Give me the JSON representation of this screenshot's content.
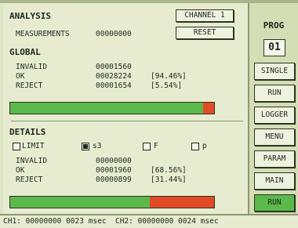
{
  "analysis": {
    "title": "ANALYSIS",
    "channel_button": "CHANNEL 1",
    "reset_button": "RESET",
    "measurements_label": "MEASUREMENTS",
    "measurements_value": "00000000"
  },
  "global": {
    "title": "GLOBAL",
    "rows": [
      {
        "label": "INVALID",
        "value": "00001560",
        "percent": ""
      },
      {
        "label": "OK",
        "value": "00028224",
        "percent": "[94.46%]"
      },
      {
        "label": "REJECT",
        "value": "00001654",
        "percent": "[5.54%]"
      }
    ],
    "bar": {
      "ok_percent": 94.46,
      "reject_percent": 5.54
    }
  },
  "details": {
    "title": "DETAILS",
    "checkboxes": [
      {
        "label": "LIMIT",
        "checked": false
      },
      {
        "label": "s3",
        "checked": true
      },
      {
        "label": "F",
        "checked": false
      },
      {
        "label": "p",
        "checked": false
      }
    ],
    "rows": [
      {
        "label": "INVALID",
        "value": "00000000",
        "percent": ""
      },
      {
        "label": "OK",
        "value": "00001960",
        "percent": "[68.56%]"
      },
      {
        "label": "REJECT",
        "value": "00000899",
        "percent": "[31.44%]"
      }
    ],
    "bar": {
      "ok_percent": 68.56,
      "reject_percent": 31.44
    }
  },
  "side": {
    "prog_label": "PROG",
    "prog_value": "01",
    "buttons": [
      "SINGLE",
      "RUN",
      "LOGGER",
      "MENU",
      "PARAM",
      "MAIN",
      "RUN"
    ]
  },
  "status": {
    "text": "CH1: 00000000 0023 msec  CH2: 00000000 0024 msec"
  },
  "colors": {
    "ok": "#5bb84a",
    "reject": "#e14a25",
    "active_button": "#5bb84a"
  }
}
